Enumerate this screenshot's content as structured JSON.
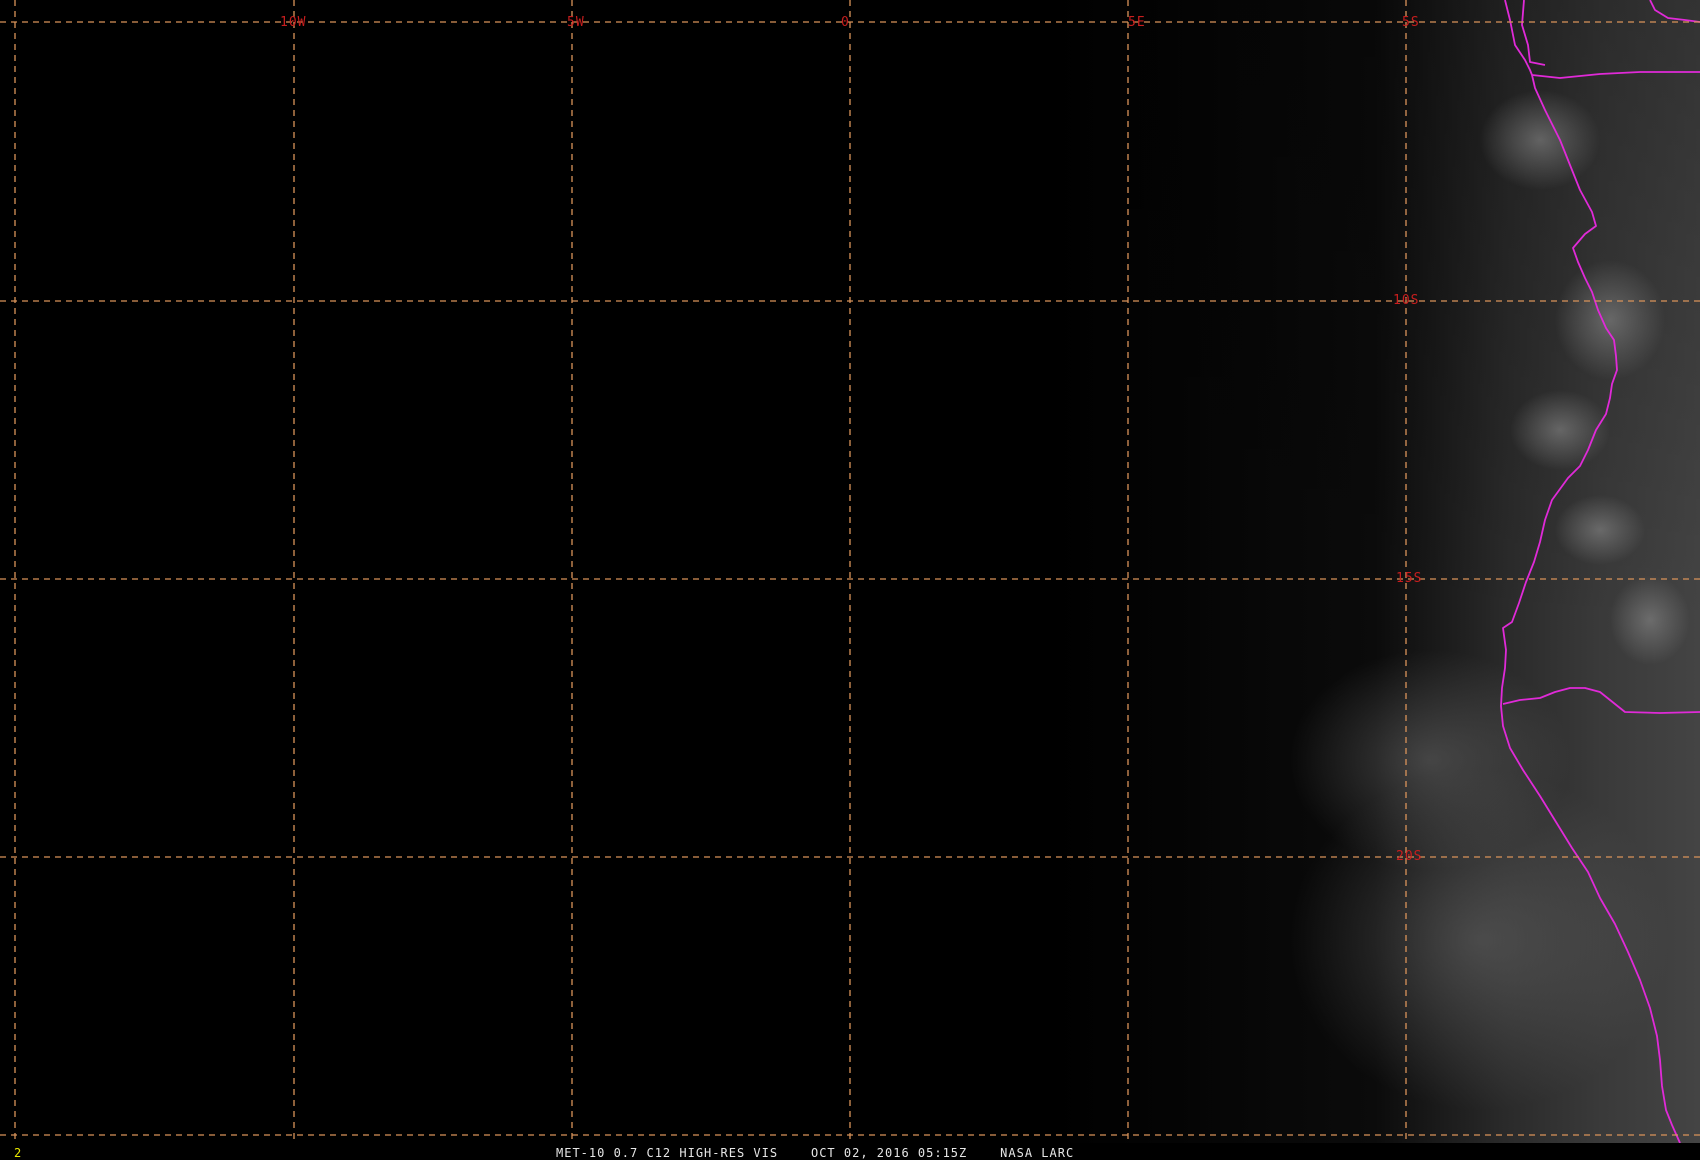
{
  "window": {
    "frame_number": "2"
  },
  "map": {
    "longitude_labels": [
      "10W",
      "5W",
      "0",
      "5E"
    ],
    "latitude_labels": [
      "5S",
      "10S",
      "15S",
      "20S"
    ],
    "colors": {
      "background": "#000000",
      "graticule": "#d9935a",
      "graticule_labels": "#c81e1e",
      "political_borders": "#e02ad8",
      "caption_text": "#e6e6e6",
      "frame_number": "#e8e800"
    },
    "layers": [
      "satellite-visible-imagery",
      "latitude-longitude-grid",
      "coastline-and-country-borders"
    ]
  },
  "caption": {
    "satellite_product": "MET-10 0.7 C12 HIGH-RES VIS",
    "timestamp": "OCT 02, 2016 05:15Z",
    "source": "NASA LARC"
  }
}
